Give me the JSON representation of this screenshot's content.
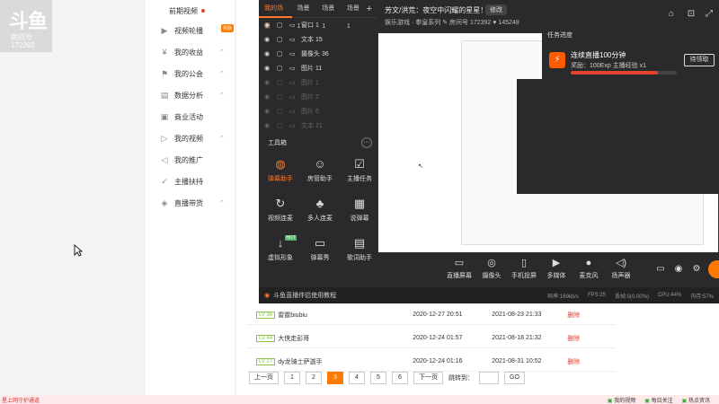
{
  "watermark": {
    "brand": "斗鱼",
    "room_label": "房间号",
    "room_id": "172392"
  },
  "sidebar": {
    "top_item": "前期视频",
    "items": [
      {
        "label": "视频轮播",
        "icon": "film-icon",
        "chev": false,
        "badge": "奖励"
      },
      {
        "label": "我的收益",
        "icon": "coin-icon",
        "chev": true
      },
      {
        "label": "我的公会",
        "icon": "group-icon",
        "chev": true
      },
      {
        "label": "数据分析",
        "icon": "chart-icon",
        "chev": true
      },
      {
        "label": "商业活动",
        "icon": "shop-icon",
        "chev": false
      },
      {
        "label": "我的视频",
        "icon": "video-icon",
        "chev": true
      },
      {
        "label": "我的推广",
        "icon": "megaphone-icon",
        "chev": false
      },
      {
        "label": "主播扶持",
        "icon": "thumb-icon",
        "chev": false
      },
      {
        "label": "直播带货",
        "icon": "bag-icon",
        "chev": true
      }
    ]
  },
  "obs": {
    "scene_tabs": [
      "我的场景",
      "场景1",
      "场景1",
      "场景1"
    ],
    "sources": [
      {
        "label": "窗口 1",
        "dim": false
      },
      {
        "label": "文本 15",
        "dim": false
      },
      {
        "label": "摄像头 36",
        "dim": false
      },
      {
        "label": "图片 11",
        "dim": false
      },
      {
        "label": "图片 1",
        "dim": true
      },
      {
        "label": "图片 2",
        "dim": true
      },
      {
        "label": "图片 6",
        "dim": true
      },
      {
        "label": "文本 21",
        "dim": true
      }
    ],
    "tools_title": "工具箱",
    "tools": [
      {
        "label": "弹幕助手",
        "icon": "danmaku-icon",
        "hot": true,
        "tag": ""
      },
      {
        "label": "房管助手",
        "icon": "admin-icon",
        "hot": false,
        "tag": ""
      },
      {
        "label": "主播任务",
        "icon": "task-icon",
        "hot": false,
        "tag": ""
      },
      {
        "label": "视频连麦",
        "icon": "link-icon",
        "hot": false,
        "tag": ""
      },
      {
        "label": "多人连麦",
        "icon": "multi-icon",
        "hot": false,
        "tag": ""
      },
      {
        "label": "说弹幕",
        "icon": "speak-icon",
        "hot": false,
        "tag": ""
      },
      {
        "label": "虚拟形象",
        "icon": "avatar-icon",
        "hot": false,
        "tag": "HOT"
      },
      {
        "label": "弹幕秀",
        "icon": "tv-icon",
        "hot": false,
        "tag": ""
      },
      {
        "label": "歌词助手",
        "icon": "lyric-icon",
        "hot": false,
        "tag": ""
      }
    ],
    "tutorial_text": "斗鱼直播伴侣使用教程",
    "title": "芳文/洪荒：夜空中闪耀的星星！",
    "tag": "修改",
    "subtitle_category": "娱乐游戏 · 拳皇系列",
    "room_label": "房间号",
    "room_id": "172392",
    "followers": "145248"
  },
  "task": {
    "title": "任务进度",
    "name": "连续直播100分钟",
    "reward": "奖励：100Exp 主播经验 x1",
    "progress_fraction": 0.82,
    "button": "待领取"
  },
  "controls": [
    {
      "label": "直播屏幕",
      "icon": "screen-icon"
    },
    {
      "label": "摄像头",
      "icon": "camera-icon"
    },
    {
      "label": "手机投屏",
      "icon": "phone-icon"
    },
    {
      "label": "多媒体",
      "icon": "media-icon"
    },
    {
      "label": "麦克风",
      "icon": "mic-icon"
    },
    {
      "label": "扬声器",
      "icon": "speaker-icon"
    }
  ],
  "stats": {
    "bitrate": "码率:169kb/s",
    "fps": "FPS:25",
    "drop": "丢帧:0(0.00%)",
    "cpu": "CPU:44%",
    "mem": "内存:57%"
  },
  "table": {
    "rows": [
      {
        "level": "LV 36",
        "name": "雷霆biubiu",
        "date1": "2020-12-27 20:51",
        "date2": "2021-08-23 21:33",
        "action": "删除"
      },
      {
        "level": "LV 44",
        "name": "大侠走彭哥",
        "date1": "2020-12-24 01:57",
        "date2": "2021-08-18 21:32",
        "action": "删除"
      },
      {
        "level": "LV 27",
        "name": "dy龙骑士萨迦手",
        "date1": "2020-12-24 01:16",
        "date2": "2021-08-31 10:52",
        "action": "删除"
      }
    ]
  },
  "pager": {
    "prev": "上一页",
    "pages": [
      "1",
      "2",
      "3",
      "4",
      "5",
      "6"
    ],
    "active": "3",
    "next": "下一页",
    "jump_label": "跳转到：",
    "go": "GO"
  },
  "statusbar": {
    "left": "星上网守护通道",
    "right": [
      "我的视频",
      "每日关注",
      "热点资讯"
    ]
  }
}
